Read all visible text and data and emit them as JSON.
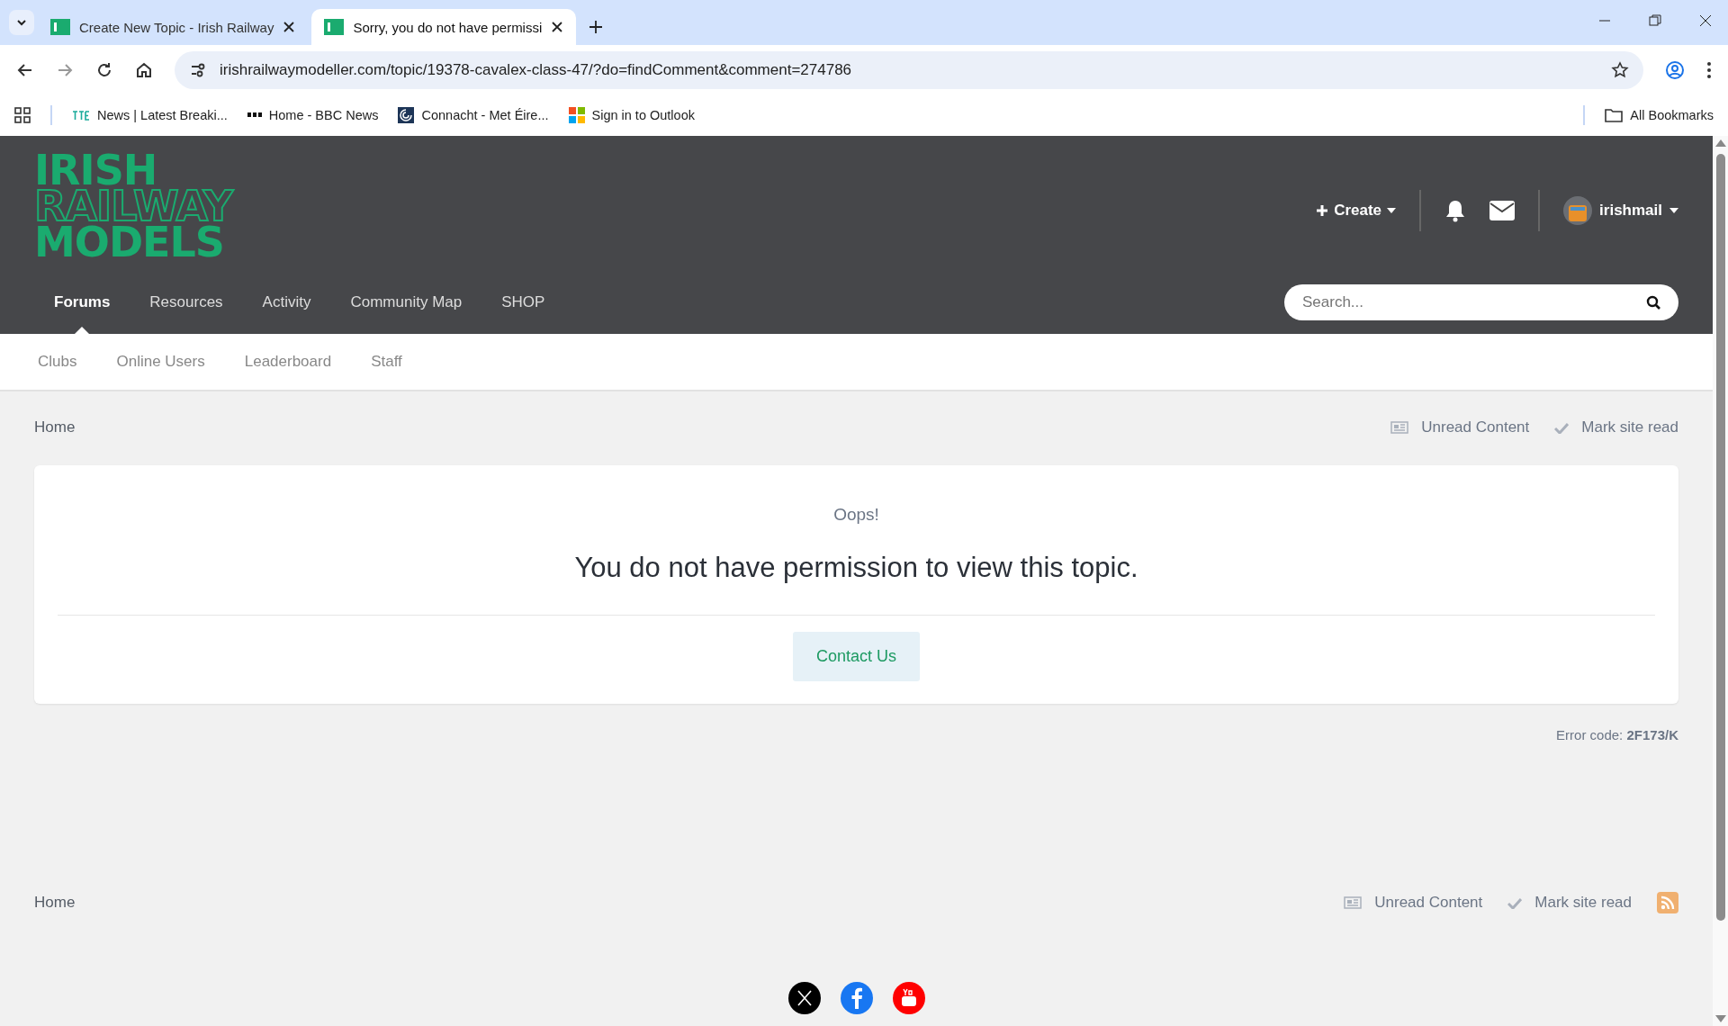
{
  "browser": {
    "tabs": [
      {
        "title": "Create New Topic - Irish Railway",
        "selected": false
      },
      {
        "title": "Sorry, you do not have permissi",
        "selected": true
      }
    ],
    "url": "irishrailwaymodeller.com/topic/19378-cavalex-class-47/?do=findComment&comment=274786",
    "bookmarks": [
      {
        "label": "News | Latest Breaki...",
        "kind": "rte"
      },
      {
        "label": "Home - BBC News",
        "kind": "bbc"
      },
      {
        "label": "Connacht - Met Éire...",
        "kind": "met"
      },
      {
        "label": "Sign in to Outlook",
        "kind": "ms"
      }
    ],
    "all_bookmarks": "All Bookmarks"
  },
  "site": {
    "logo": [
      "IRISH",
      "RAILWAY",
      "MODELS"
    ],
    "create": "Create",
    "user": "irishmail",
    "nav": [
      {
        "label": "Forums",
        "selected": true
      },
      {
        "label": "Resources",
        "selected": false
      },
      {
        "label": "Activity",
        "selected": false
      },
      {
        "label": "Community Map",
        "selected": false
      },
      {
        "label": "SHOP",
        "selected": false
      }
    ],
    "search": {
      "placeholder": "Search..."
    },
    "subnav": [
      "Clubs",
      "Online Users",
      "Leaderboard",
      "Staff"
    ]
  },
  "breadcrumb": {
    "home": "Home",
    "unread": "Unread Content",
    "mark_read": "Mark site read"
  },
  "error": {
    "heading": "Oops!",
    "message": "You do not have permission to view this topic.",
    "button": "Contact Us",
    "code_label": "Error code:",
    "code": "2F173/K"
  },
  "footer": {
    "home": "Home",
    "unread": "Unread Content",
    "mark_read": "Mark site read"
  }
}
